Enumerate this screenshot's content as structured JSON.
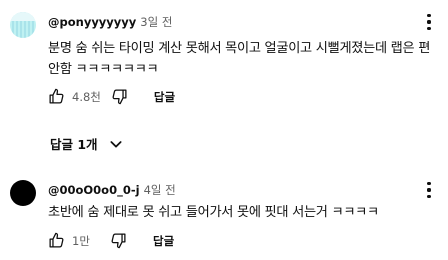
{
  "comments": [
    {
      "author": "@ponyyyyyyy",
      "time": "3일 전",
      "text": "분명 숨 쉬는 타이밍 계산 못해서 목이고 얼굴이고 시뻘게졌는데 랩은 편안함 ㅋㅋㅋㅋㅋㅋㅋ",
      "likes": "4.8천",
      "reply_label": "답글",
      "avatar_color": "#bff1f2"
    },
    {
      "author": "@00oO0o0_0-j",
      "time": "4일 전",
      "text": "초반에 숨 제대로 못 쉬고 들어가서 못에 핏대 서는거 ㅋㅋㅋㅋ",
      "likes": "1만",
      "reply_label": "답글",
      "avatar_color": "#000000"
    }
  ],
  "replies_toggle": {
    "label": "답글 1개",
    "icon": "chevron-down-icon"
  },
  "icons": {
    "like": "thumbs-up-icon",
    "dislike": "thumbs-down-icon",
    "menu": "more-vert-icon"
  }
}
